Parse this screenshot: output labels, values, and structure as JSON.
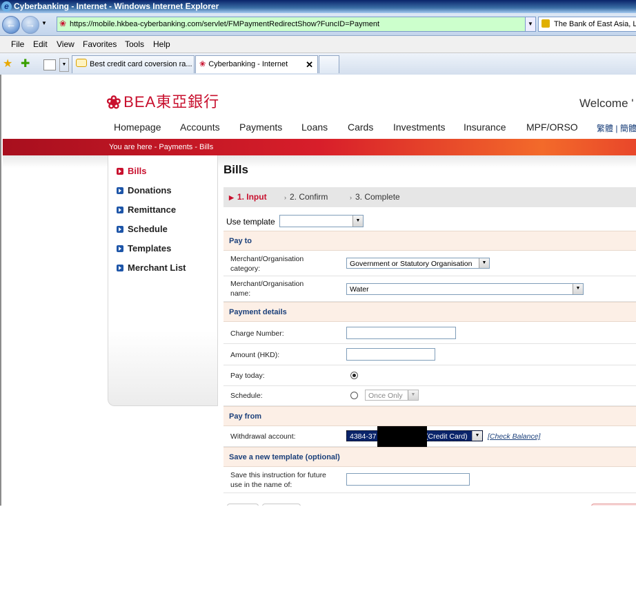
{
  "window": {
    "title": "Cyberbanking - Internet - Windows Internet Explorer"
  },
  "browser": {
    "url": "https://mobile.hkbea-cyberbanking.com/servlet/FMPaymentRedirectShow?FuncID=Payment",
    "cert_text": "The Bank of East Asia, Li",
    "menu": [
      "File",
      "Edit",
      "View",
      "Favorites",
      "Tools",
      "Help"
    ],
    "tabs": [
      {
        "label": "Best credit card coversion ra..."
      },
      {
        "label": "Cyberbanking - Internet"
      }
    ]
  },
  "site": {
    "logo_text": "BEA東亞銀行",
    "welcome": "Welcome",
    "nav": [
      "Homepage",
      "Accounts",
      "Payments",
      "Loans",
      "Cards",
      "Investments",
      "Insurance",
      "MPF/ORSO"
    ],
    "lang_links": [
      "繁體",
      "簡體"
    ],
    "breadcrumb": "You are here - Payments - Bills"
  },
  "left_menu": [
    {
      "label": "Bills",
      "selected": true
    },
    {
      "label": "Donations"
    },
    {
      "label": "Remittance"
    },
    {
      "label": "Schedule"
    },
    {
      "label": "Templates"
    },
    {
      "label": "Merchant List"
    }
  ],
  "main": {
    "title": "Bills",
    "steps": [
      "1. Input",
      "2. Confirm",
      "3. Complete"
    ],
    "use_template_label": "Use template",
    "sections": {
      "pay_to": "Pay to",
      "payment_details": "Payment details",
      "pay_from": "Pay from",
      "save_template": "Save a new template (optional)"
    },
    "fields": {
      "merchant_category_label": "Merchant/Organisation category:",
      "merchant_category_value": "Government or Statutory Organisation",
      "merchant_name_label": "Merchant/Organisation name:",
      "merchant_name_value": "Water",
      "charge_number_label": "Charge Number:",
      "amount_label": "Amount (HKD):",
      "pay_today_label": "Pay today:",
      "schedule_label": "Schedule:",
      "schedule_value": "Once Only",
      "withdrawal_label": "Withdrawal account:",
      "withdrawal_value_start": "4384-37",
      "withdrawal_value_end": "(Credit Card)",
      "check_balance": "[Check Balance]",
      "save_instruction_label": "Save this instruction for future use in the name of:"
    }
  }
}
